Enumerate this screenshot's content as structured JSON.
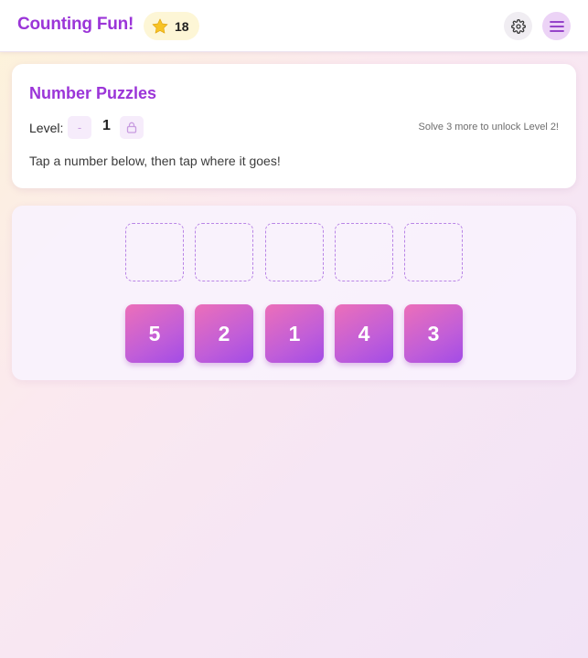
{
  "header": {
    "title": "Counting Fun!",
    "stars_count": "18",
    "star_icon": "star-icon",
    "settings_icon": "gear-icon",
    "menu_icon": "hamburger-menu-icon"
  },
  "puzzle_card": {
    "title": "Number Puzzles",
    "level_label": "Level:",
    "level_decrement_label": "-",
    "level_value": "1",
    "lock_icon": "lock-icon",
    "unlock_hint": "Solve 3 more to unlock Level 2!",
    "instruction": "Tap a number below, then tap where it goes!"
  },
  "board": {
    "slot_count": 5,
    "slots": [
      "",
      "",
      "",
      "",
      ""
    ],
    "tiles": [
      "5",
      "2",
      "1",
      "4",
      "3"
    ]
  },
  "colors": {
    "accent": "#9b35d8",
    "tile_gradient_start": "#ec6fb9",
    "tile_gradient_end": "#a34ce6",
    "slot_border": "#b985e6"
  }
}
